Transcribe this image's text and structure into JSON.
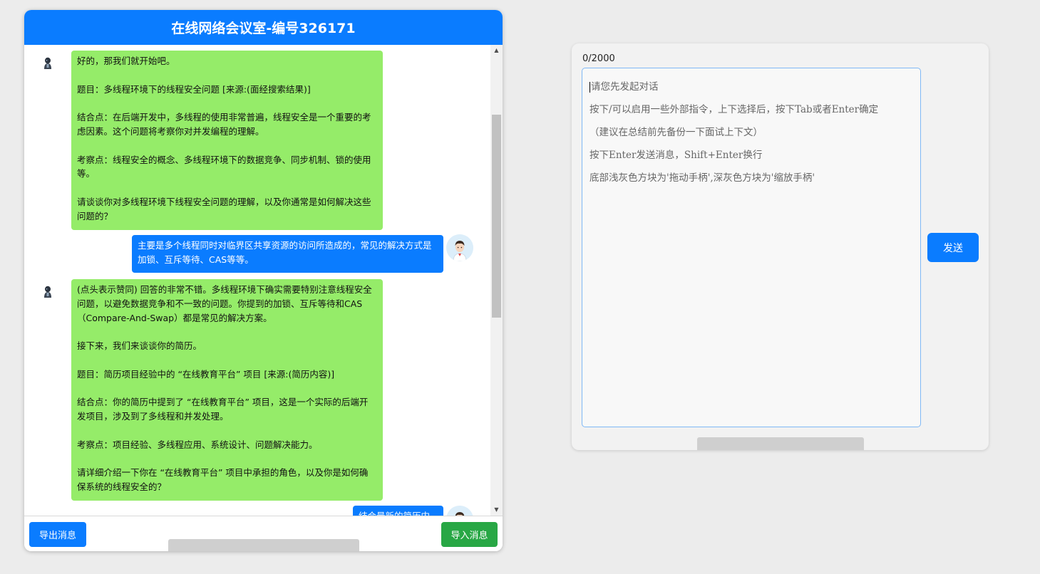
{
  "chat": {
    "title": "在线网络会议室-编号326171",
    "messages": [
      {
        "role": "bot",
        "text": "好的，那我们就开始吧。\n\n题目：多线程环境下的线程安全问题 [来源:(面经搜索结果)]\n\n结合点：在后端开发中，多线程的使用非常普遍，线程安全是一个重要的考\n虑因素。这个问题将考察你对并发编程的理解。\n\n考察点：线程安全的概念、多线程环境下的数据竞争、同步机制、锁的使用\n等。\n\n请谈谈你对多线程环境下线程安全问题的理解，以及你通常是如何解决这些\n问题的？"
      },
      {
        "role": "user",
        "text": "主要是多个线程同时对临界区共享资源的访问所造成的，常见的解决方式是\n加锁、互斥等待、CAS等等。"
      },
      {
        "role": "bot",
        "text": "(点头表示赞同) 回答的非常不错。多线程环境下确实需要特别注意线程安全\n问题，以避免数据竞争和不一致的问题。你提到的加锁、互斥等待和CAS\n（Compare-And-Swap）都是常见的解决方案。\n\n接下来，我们来谈谈你的简历。\n\n题目：简历项目经验中的 “在线教育平台” 项目 [来源:(简历内容)]\n\n结合点：你的简历中提到了 “在线教育平台” 项目，这是一个实际的后端开\n发项目，涉及到了多线程和并发处理。\n\n考察点：项目经验、多线程应用、系统设计、问题解决能力。\n\n请详细介绍一下你在 “在线教育平台” 项目中承担的角色，以及你是如何确\n保系统的线程安全的？"
      },
      {
        "role": "user",
        "text": "结合最新的简历内容"
      }
    ],
    "export_label": "导出消息",
    "import_label": "导入消息"
  },
  "input": {
    "char_count": "0/2000",
    "placeholder_lines": [
      "请您先发起对话",
      "按下/可以启用一些外部指令，上下选择后，按下Tab或者Enter确定",
      "（建议在总结前先备份一下面试上下文）",
      "按下Enter发送消息，Shift+Enter换行",
      "底部浅灰色方块为'拖动手柄',深灰色方块为'缩放手柄'"
    ],
    "send_label": "发送"
  },
  "colors": {
    "header_blue": "#0a7cff",
    "bot_bubble": "#95ec69",
    "user_bubble": "#0a7cff",
    "import_green": "#28a745"
  }
}
